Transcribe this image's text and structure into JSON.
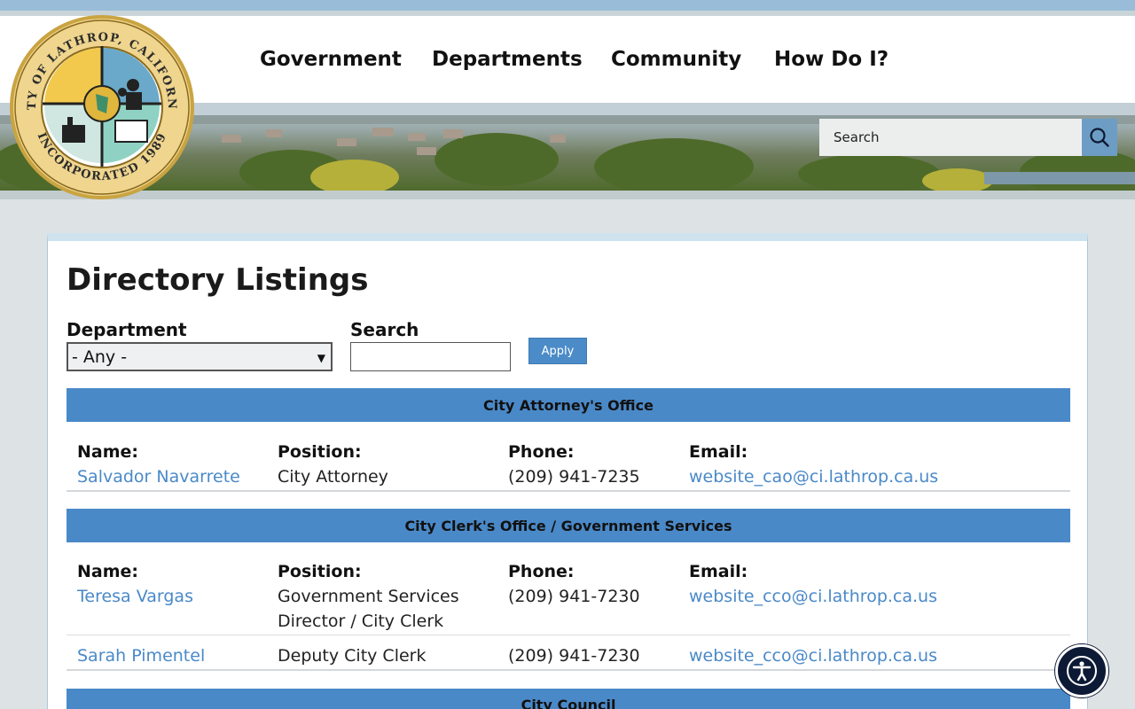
{
  "logo": {
    "top_text": "CITY OF LATHROP, CALIFORNIA",
    "bottom_text": "INCORPORATED 1989"
  },
  "nav": {
    "items": [
      "Government",
      "Departments",
      "Community",
      "How Do I?"
    ]
  },
  "site_search": {
    "placeholder": "Search"
  },
  "page": {
    "title": "Directory Listings"
  },
  "filters": {
    "department_label": "Department",
    "department_value": "- Any -",
    "search_label": "Search",
    "search_value": "",
    "apply_label": "Apply"
  },
  "columns": {
    "name": "Name:",
    "position": "Position:",
    "phone": "Phone:",
    "email": "Email:"
  },
  "groups": [
    {
      "title": "City Attorney's Office",
      "rows": [
        {
          "name": "Salvador Navarrete",
          "position": "City Attorney",
          "phone": "(209) 941-7235",
          "email": "website_cao@ci.lathrop.ca.us"
        }
      ]
    },
    {
      "title": "City Clerk's Office / Government Services",
      "rows": [
        {
          "name": "Teresa Vargas",
          "position_line1": "Government Services",
          "position_line2": "Director / City Clerk",
          "phone": "(209) 941-7230",
          "email": "website_cco@ci.lathrop.ca.us"
        },
        {
          "name": "Sarah Pimentel",
          "position": "Deputy City Clerk",
          "phone": "(209) 941-7230",
          "email": "website_cco@ci.lathrop.ca.us"
        }
      ]
    },
    {
      "title": "City Council",
      "rows": []
    }
  ],
  "icons": {
    "search": "magnifier-icon",
    "accessibility": "accessibility-person-icon"
  },
  "colors": {
    "accent": "#4a89c8",
    "header_strip": "#99bdd8",
    "a11y": "#0d1a35"
  }
}
